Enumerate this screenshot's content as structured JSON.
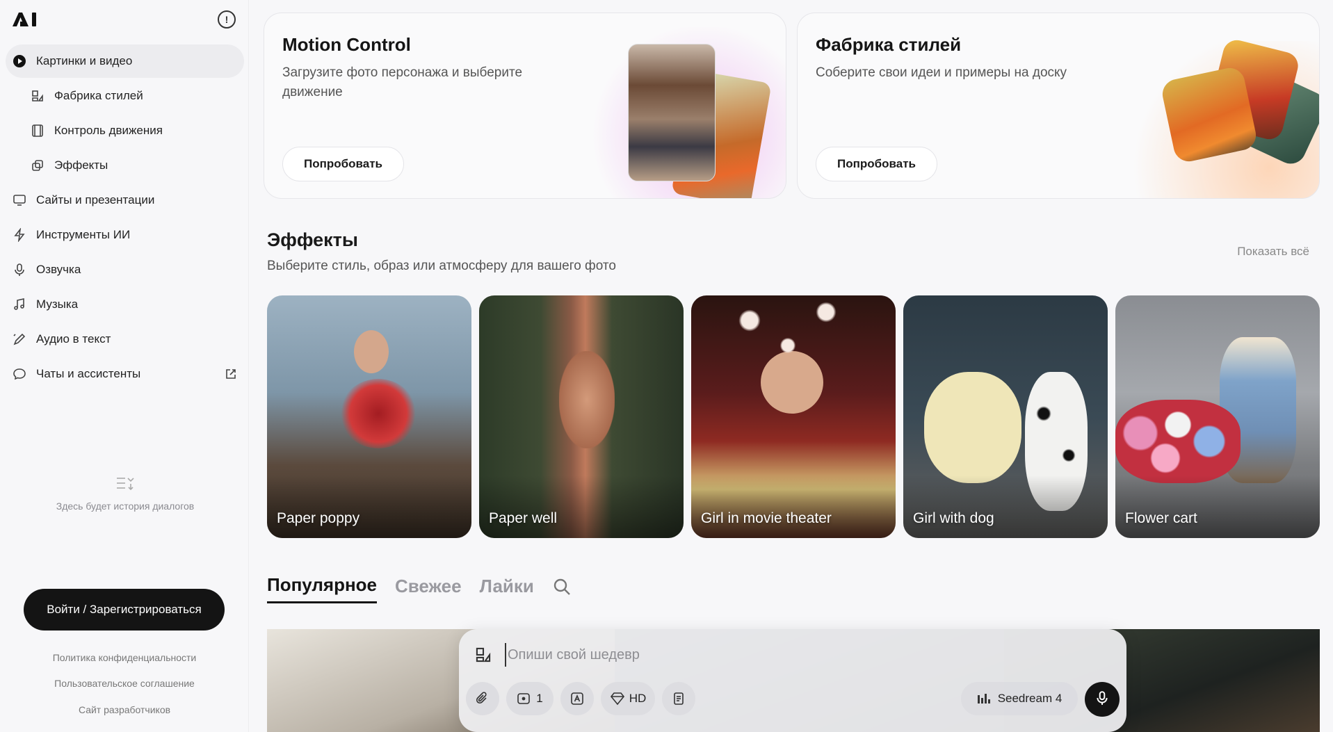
{
  "sidebar": {
    "logo_text": "AI",
    "items": [
      {
        "label": "Картинки и видео",
        "icon": "play-circle-icon",
        "active": true
      },
      {
        "label": "Фабрика стилей",
        "icon": "style-factory-icon"
      },
      {
        "label": "Контроль движения",
        "icon": "film-icon"
      },
      {
        "label": "Эффекты",
        "icon": "effects-icon"
      },
      {
        "label": "Сайты и презентации",
        "icon": "monitor-icon"
      },
      {
        "label": "Инструменты ИИ",
        "icon": "lightning-icon"
      },
      {
        "label": "Озвучка",
        "icon": "microphone-icon"
      },
      {
        "label": "Музыка",
        "icon": "music-note-icon"
      },
      {
        "label": "Аудио в текст",
        "icon": "pen-icon"
      },
      {
        "label": "Чаты и ассистенты",
        "icon": "chat-bubble-icon"
      }
    ],
    "history_empty": "Здесь будет история диалогов",
    "login_label": "Войти / Зарегистрироваться",
    "footer_links": [
      "Политика конфиденциальности",
      "Пользовательское соглашение",
      "Сайт разработчиков"
    ]
  },
  "cards": [
    {
      "title": "Motion Control",
      "description": "Загрузите фото персонажа и выберите движение",
      "button": "Попробовать"
    },
    {
      "title": "Фабрика стилей",
      "description": "Соберите свои идеи и примеры на доску",
      "button": "Попробовать"
    }
  ],
  "effects": {
    "title": "Эффекты",
    "description": "Выберите стиль, образ или атмосферу для вашего фото",
    "show_all": "Показать всё",
    "items": [
      {
        "label": "Paper poppy"
      },
      {
        "label": "Paper well"
      },
      {
        "label": "Girl in movie theater"
      },
      {
        "label": "Girl with dog"
      },
      {
        "label": "Flower cart"
      }
    ]
  },
  "tabs": [
    {
      "label": "Популярное",
      "active": true
    },
    {
      "label": "Свежее"
    },
    {
      "label": "Лайки"
    }
  ],
  "composer": {
    "placeholder": "Опиши свой шедевр",
    "count": "1",
    "quality": "HD",
    "model": "Seedream 4"
  },
  "colors": {
    "accent": "#141414",
    "background": "#f7f7f9",
    "card_glow_pink": "#e896eb",
    "card_glow_orange": "#ffbe8c"
  }
}
